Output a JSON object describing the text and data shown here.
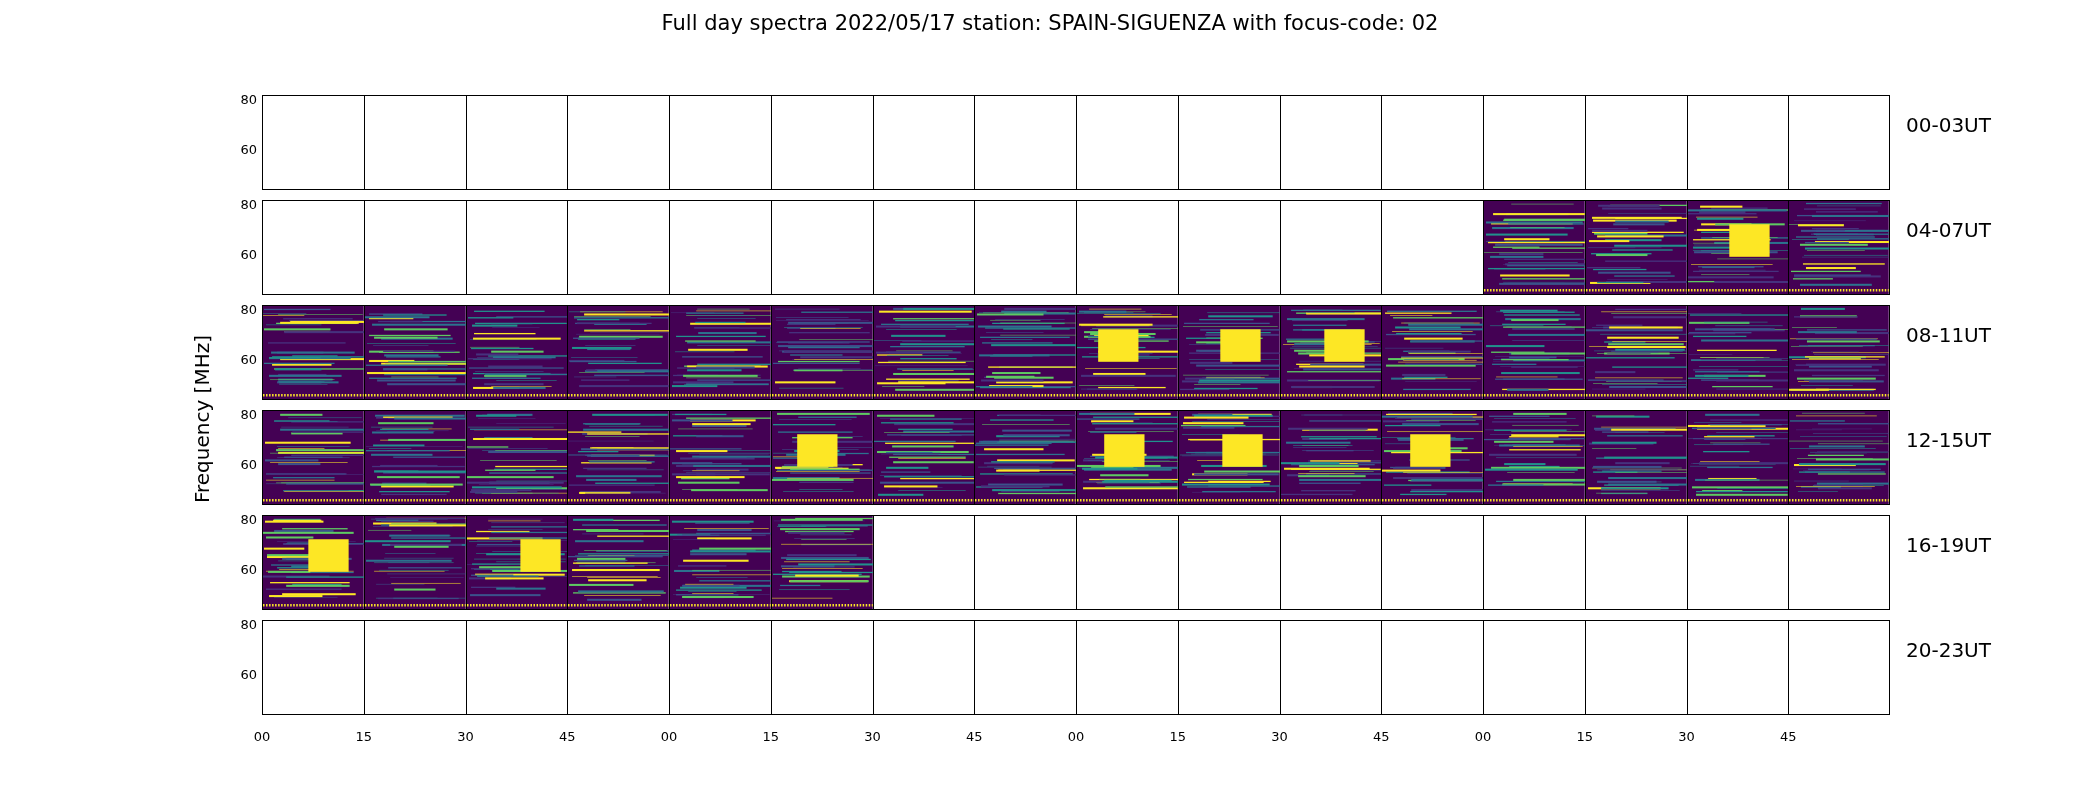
{
  "title": "Full day spectra 2022/05/17 station: SPAIN-SIGUENZA with focus-code: 02",
  "ylabel": "Frequency [MHz]",
  "rows": [
    {
      "label": "00-03UT",
      "yticks": [
        "80",
        "60"
      ],
      "panels": [
        {
          "filled": false
        },
        {
          "filled": false
        },
        {
          "filled": false
        },
        {
          "filled": false
        },
        {
          "filled": false
        },
        {
          "filled": false
        },
        {
          "filled": false
        },
        {
          "filled": false
        },
        {
          "filled": false
        },
        {
          "filled": false
        },
        {
          "filled": false
        },
        {
          "filled": false
        },
        {
          "filled": false
        },
        {
          "filled": false
        },
        {
          "filled": false
        },
        {
          "filled": false
        }
      ]
    },
    {
      "label": "04-07UT",
      "yticks": [
        "80",
        "60"
      ],
      "panels": [
        {
          "filled": false
        },
        {
          "filled": false
        },
        {
          "filled": false
        },
        {
          "filled": false
        },
        {
          "filled": false
        },
        {
          "filled": false
        },
        {
          "filled": false
        },
        {
          "filled": false
        },
        {
          "filled": false
        },
        {
          "filled": false
        },
        {
          "filled": false
        },
        {
          "filled": false
        },
        {
          "filled": true
        },
        {
          "filled": true
        },
        {
          "filled": true
        },
        {
          "filled": true
        }
      ]
    },
    {
      "label": "08-11UT",
      "yticks": [
        "80",
        "60"
      ],
      "panels": [
        {
          "filled": true
        },
        {
          "filled": true
        },
        {
          "filled": true
        },
        {
          "filled": true
        },
        {
          "filled": true
        },
        {
          "filled": true
        },
        {
          "filled": true
        },
        {
          "filled": true
        },
        {
          "filled": true
        },
        {
          "filled": true
        },
        {
          "filled": true
        },
        {
          "filled": true
        },
        {
          "filled": true
        },
        {
          "filled": true
        },
        {
          "filled": true
        },
        {
          "filled": true
        }
      ]
    },
    {
      "label": "12-15UT",
      "yticks": [
        "80",
        "60"
      ],
      "panels": [
        {
          "filled": true
        },
        {
          "filled": true
        },
        {
          "filled": true
        },
        {
          "filled": true
        },
        {
          "filled": true
        },
        {
          "filled": true
        },
        {
          "filled": true
        },
        {
          "filled": true
        },
        {
          "filled": true
        },
        {
          "filled": true
        },
        {
          "filled": true
        },
        {
          "filled": true
        },
        {
          "filled": true
        },
        {
          "filled": true
        },
        {
          "filled": true
        },
        {
          "filled": true
        }
      ]
    },
    {
      "label": "16-19UT",
      "yticks": [
        "80",
        "60"
      ],
      "panels": [
        {
          "filled": true
        },
        {
          "filled": true
        },
        {
          "filled": true
        },
        {
          "filled": true
        },
        {
          "filled": true
        },
        {
          "filled": true
        },
        {
          "filled": false
        },
        {
          "filled": false
        },
        {
          "filled": false
        },
        {
          "filled": false
        },
        {
          "filled": false
        },
        {
          "filled": false
        },
        {
          "filled": false
        },
        {
          "filled": false
        },
        {
          "filled": false
        },
        {
          "filled": false
        }
      ]
    },
    {
      "label": "20-23UT",
      "yticks": [
        "80",
        "60"
      ],
      "panels": [
        {
          "filled": false
        },
        {
          "filled": false
        },
        {
          "filled": false
        },
        {
          "filled": false
        },
        {
          "filled": false
        },
        {
          "filled": false
        },
        {
          "filled": false
        },
        {
          "filled": false
        },
        {
          "filled": false
        },
        {
          "filled": false
        },
        {
          "filled": false
        },
        {
          "filled": false
        },
        {
          "filled": false
        },
        {
          "filled": false
        },
        {
          "filled": false
        },
        {
          "filled": false
        }
      ]
    }
  ],
  "xticks": [
    "00",
    "15",
    "30",
    "45",
    "00",
    "15",
    "30",
    "45",
    "00",
    "15",
    "30",
    "45",
    "00",
    "15",
    "30",
    "45"
  ]
}
